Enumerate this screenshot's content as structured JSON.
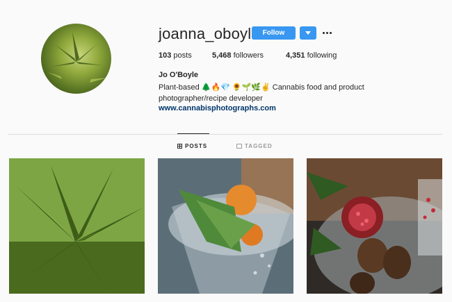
{
  "profile": {
    "username": "joanna_oboyle",
    "follow_label": "Follow",
    "full_name": "Jo O'Boyle",
    "bio_line1": "Plant-based 🌲🔥💎 🌻🌱🌿✌️ Cannabis food and product",
    "bio_line2": "photographer/recipe developer",
    "website": "www.cannabisphotographs.com"
  },
  "stats": {
    "posts_count": "103",
    "posts_label": "posts",
    "followers_count": "5,468",
    "followers_label": "followers",
    "following_count": "4,351",
    "following_label": "following"
  },
  "tabs": {
    "posts": "POSTS",
    "tagged": "TAGGED"
  },
  "icons": {
    "dropdown": "chevron-down-icon",
    "more": "more-options-icon",
    "posts_tab": "grid-icon",
    "tagged_tab": "tag-icon"
  },
  "colors": {
    "follow_button": "#3897f0",
    "link": "#003569",
    "background": "#fafafa"
  }
}
